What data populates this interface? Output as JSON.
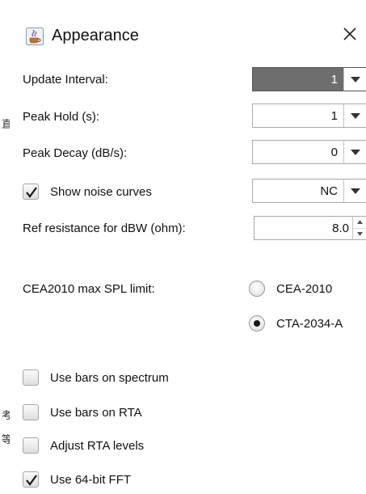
{
  "window": {
    "title": "Appearance",
    "icon": "java-cup-icon",
    "close_icon": "close-icon"
  },
  "left_edge": {
    "chars": [
      "直",
      "考",
      "等"
    ]
  },
  "fields": [
    {
      "label": "Update Interval:",
      "value": "1",
      "selected": true
    },
    {
      "label": "Peak Hold (s):",
      "value": "1",
      "selected": false
    },
    {
      "label": "Peak Decay (dB/s):",
      "value": "0",
      "selected": false
    },
    {
      "label": "Show noise curves",
      "value": "NC",
      "checked": true
    }
  ],
  "ref_resistance": {
    "label": "Ref resistance for dBW (ohm):",
    "value": "8.0"
  },
  "spl_limit": {
    "label": "CEA2010 max SPL limit:",
    "options": [
      {
        "label": "CEA-2010",
        "selected": false
      },
      {
        "label": "CTA-2034-A",
        "selected": true
      }
    ]
  },
  "checkboxes": [
    {
      "label": "Use bars on spectrum",
      "checked": false
    },
    {
      "label": "Use bars on RTA",
      "checked": false
    },
    {
      "label": "Adjust RTA levels",
      "checked": false
    },
    {
      "label": "Use 64-bit FFT",
      "checked": true
    }
  ],
  "colors": {
    "selected_combo": "#6e6e6e",
    "border": "#a9a9a9",
    "text": "#111111"
  }
}
